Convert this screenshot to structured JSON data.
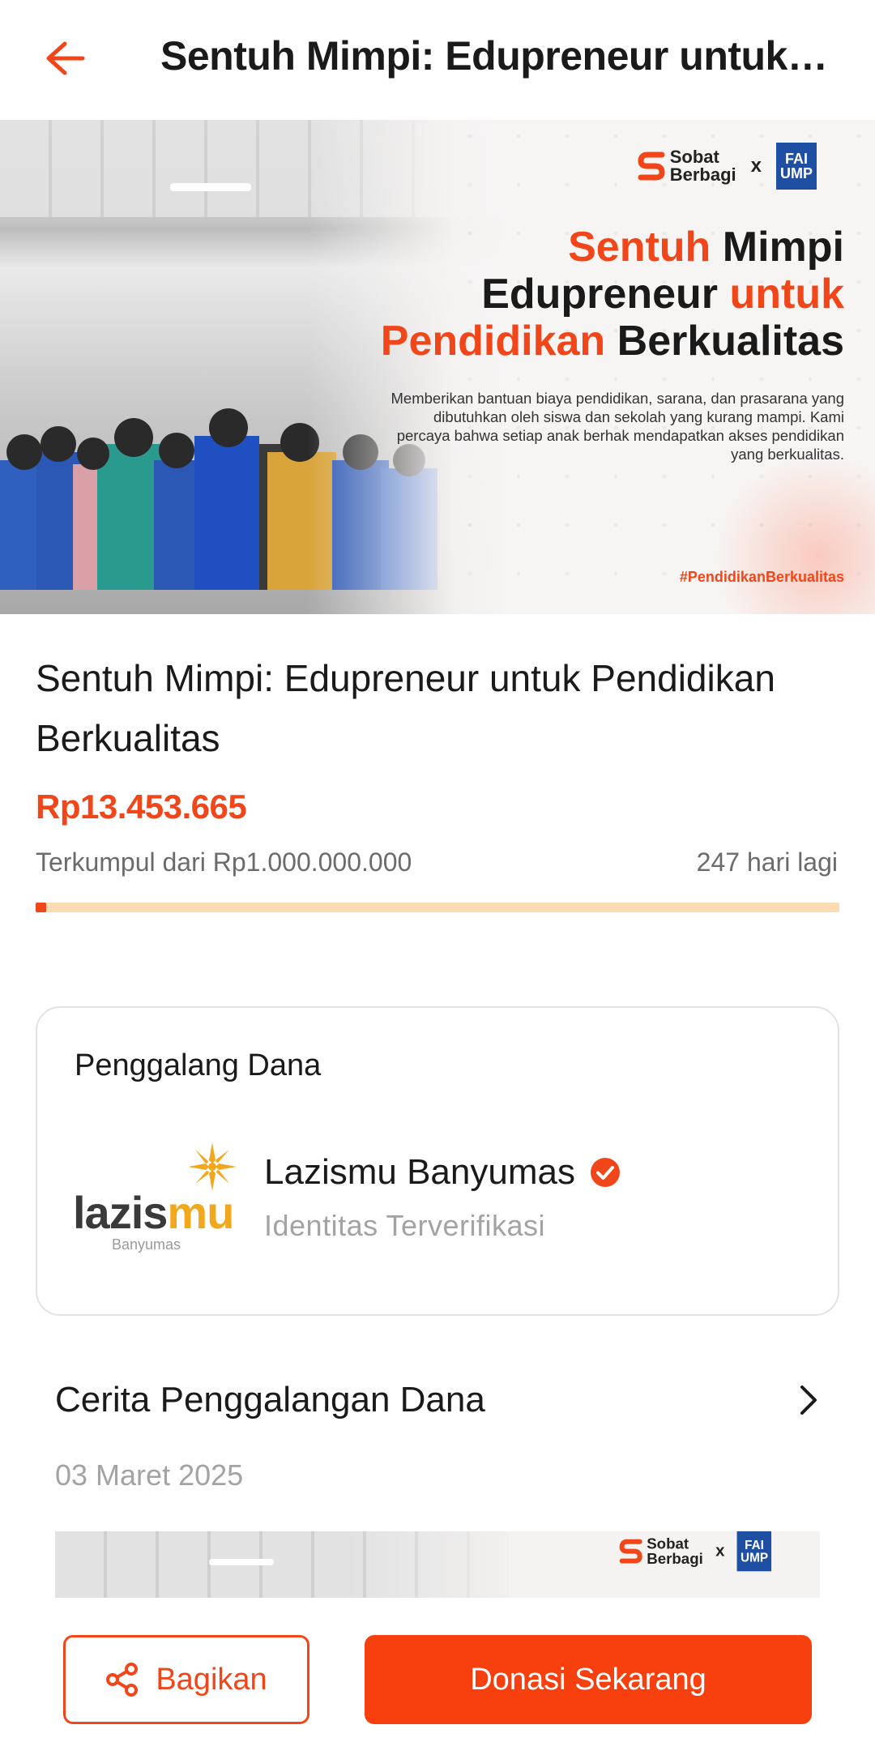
{
  "header": {
    "title": "Sentuh Mimpi: Edupreneur untuk Pendidikan Berkualitas",
    "back_icon": "arrow-left-icon"
  },
  "banner": {
    "partner_left_line1": "Sobat",
    "partner_left_line2": "Berbagi",
    "partner_separator": "x",
    "partner_right_line1": "FAI",
    "partner_right_line2": "UMP",
    "headline_l1_a": "Sentuh",
    "headline_l1_b": " Mimpi",
    "headline_l2_a": "Edupreneur ",
    "headline_l2_b": "untuk",
    "headline_l3_a": "Pendidikan",
    "headline_l3_b": " Berkualitas",
    "description": "Memberikan bantuan biaya pendidikan, sarana, dan prasarana yang dibutuhkan oleh siswa dan sekolah yang kurang mampi. Kami percaya bahwa setiap anak berhak mendapatkan akses pendidikan yang berkualitas.",
    "hashtag": "#PendidikanBerkualitas"
  },
  "campaign": {
    "title": "Sentuh Mimpi: Edupreneur untuk Pendidikan Berkualitas",
    "amount": "Rp13.453.665",
    "raised_label": "Terkumpul dari Rp1.000.000.000",
    "days_left": "247 hari lagi",
    "progress_fraction": 0.0135
  },
  "fundraiser": {
    "section_title": "Penggalang Dana",
    "logo_word_a": "lazis",
    "logo_word_b": "mu",
    "logo_sub": "Banyumas",
    "name": "Lazismu Banyumas",
    "status": "Identitas Terverifikasi"
  },
  "story": {
    "title": "Cerita Penggalangan Dana",
    "date": "03 Maret 2025"
  },
  "actions": {
    "share_label": "Bagikan",
    "donate_label": "Donasi Sekarang"
  },
  "colors": {
    "accent": "#f1461a",
    "progress_track": "#fbdcb3"
  }
}
